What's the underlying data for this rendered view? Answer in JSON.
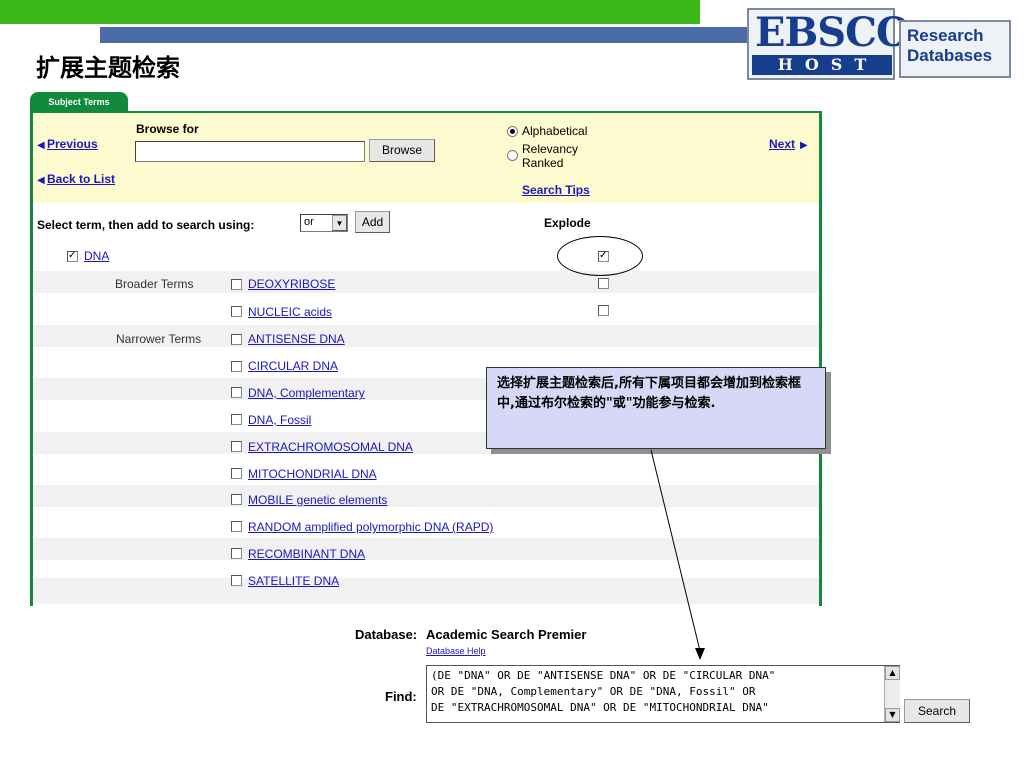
{
  "slide_title": "扩展主题检索",
  "logo": {
    "ebsco": "EBSCO",
    "host": "HOST",
    "research": "Research",
    "databases": "Databases"
  },
  "tab_label": "Subject Terms",
  "browse": {
    "label": "Browse for",
    "input_value": "",
    "button": "Browse",
    "previous": "Previous",
    "next": "Next",
    "back_to_list": "Back to List",
    "options": [
      "Alphabetical",
      "Relevancy Ranked"
    ],
    "selected_option": "Alphabetical",
    "search_tips": "Search Tips"
  },
  "select_bar": {
    "label": "Select term, then add to search using:",
    "operator": "or",
    "add_button": "Add",
    "explode_header": "Explode"
  },
  "main_term": {
    "label": "DNA",
    "checked": true,
    "explode_checked": true
  },
  "broader_label": "Broader Terms",
  "broader_terms": [
    "DEOXYRIBOSE",
    "NUCLEIC acids"
  ],
  "narrower_label": "Narrower Terms",
  "narrower_terms": [
    "ANTISENSE DNA",
    "CIRCULAR DNA",
    "DNA, Complementary",
    "DNA, Fossil",
    "EXTRACHROMOSOMAL DNA",
    "MITOCHONDRIAL DNA",
    "MOBILE genetic elements",
    "RANDOM amplified polymorphic DNA (RAPD)",
    "RECOMBINANT DNA",
    "SATELLITE DNA"
  ],
  "callout_text": "选择扩展主题检索后,所有下属项目都会增加到检索框中,通过布尔检索的\"或\"功能参与检索.",
  "database": {
    "label": "Database:",
    "name": "Academic Search Premier",
    "help": "Database Help"
  },
  "find": {
    "label": "Find:",
    "query": "(DE \"DNA\" OR DE \"ANTISENSE DNA\" OR DE \"CIRCULAR DNA\"\nOR DE \"DNA, Complementary\" OR DE \"DNA, Fossil\" OR\nDE \"EXTRACHROMOSOMAL DNA\" OR DE \"MITOCHONDRIAL DNA\"",
    "search_button": "Search"
  },
  "colors": {
    "green_bar": "#3cb71a",
    "blue_bar": "#4a6aa8",
    "panel_border": "#118a3c",
    "header_bg": "#fdfacf",
    "link": "#1a17bd",
    "callout_bg": "#d7d7f7",
    "ebsco_blue": "#173d8d"
  }
}
